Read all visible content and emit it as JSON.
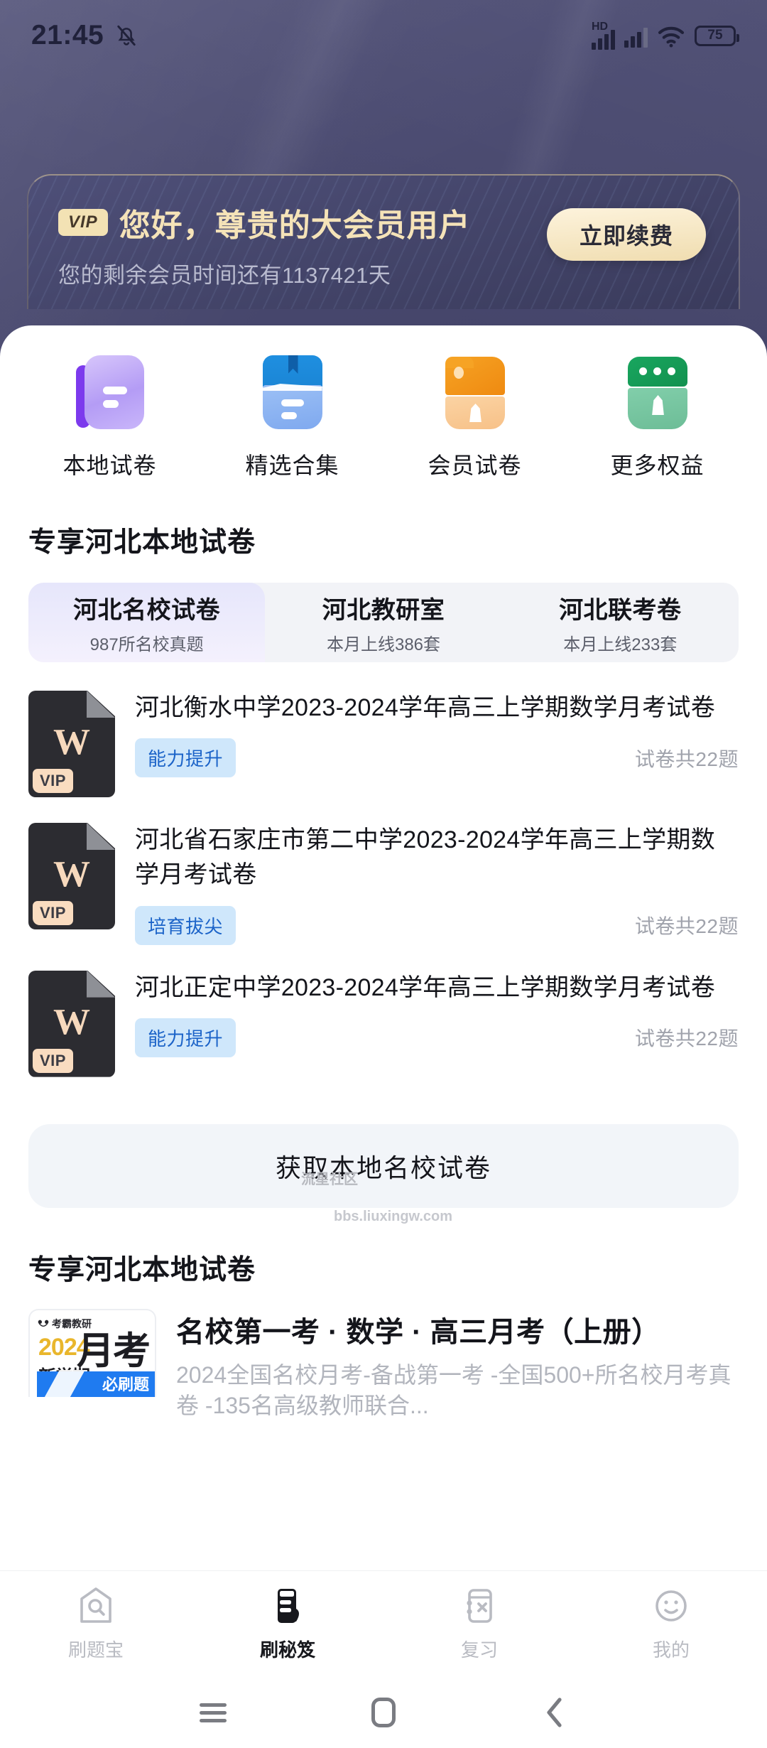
{
  "status_bar": {
    "time": "21:45",
    "mute_icon": "bell-muted-icon",
    "network_label": "HD",
    "signal_icon": "signal-bars-icon",
    "signal_icon_2": "signal-bars-icon",
    "wifi_icon": "wifi-icon",
    "battery_level": "75"
  },
  "vip_card": {
    "badge": "VIP",
    "greeting": "您好，尊贵的大会员用户",
    "remaining": "您的剩余会员时间还有1137421天",
    "renew_button": "立即续费",
    "accent_gold": "#f5e3b8"
  },
  "quick_actions": [
    {
      "label": "本地试卷",
      "icon": "local-papers-icon",
      "color": "#8b5cf6"
    },
    {
      "label": "精选合集",
      "icon": "featured-collection-icon",
      "color": "#1f8fe0"
    },
    {
      "label": "会员试卷",
      "icon": "member-papers-icon",
      "color": "#f5941f"
    },
    {
      "label": "更多权益",
      "icon": "more-benefits-icon",
      "color": "#17a765"
    }
  ],
  "section_one": {
    "title": "专享河北本地试卷",
    "tabs": [
      {
        "label": "河北名校试卷",
        "sub": "987所名校真题",
        "active": true
      },
      {
        "label": "河北教研室",
        "sub": "本月上线386套",
        "active": false
      },
      {
        "label": "河北联考卷",
        "sub": "本月上线233套",
        "active": false
      }
    ],
    "papers": [
      {
        "icon": "word-document-icon",
        "icon_letter": "W",
        "vip_badge": "VIP",
        "title": "河北衡水中学2023-2024学年高三上学期数学月考试卷",
        "tag": "能力提升",
        "count": "试卷共22题"
      },
      {
        "icon": "word-document-icon",
        "icon_letter": "W",
        "vip_badge": "VIP",
        "title": "河北省石家庄市第二中学2023-2024学年高三上学期数学月考试卷",
        "tag": "培育拔尖",
        "count": "试卷共22题"
      },
      {
        "icon": "word-document-icon",
        "icon_letter": "W",
        "vip_badge": "VIP",
        "title": "河北正定中学2023-2024学年高三上学期数学月考试卷",
        "tag": "能力提升",
        "count": "试卷共22题"
      }
    ],
    "cta": "获取本地名校试卷"
  },
  "section_two": {
    "title": "专享河北本地试卷",
    "book": {
      "cover": {
        "brand": "考霸教研",
        "year": "2024",
        "term": "新学期",
        "exam": "月考",
        "band": "必刷题"
      },
      "title": "名校第一考 · 数学 · 高三月考（上册）",
      "desc": "2024全国名校月考-备战第一考 -全国500+所名校月考真卷 -135名高级教师联合..."
    }
  },
  "watermark": {
    "line1": "流星社区",
    "line2": "bbs.liuxingw.com"
  },
  "bottom_tabs": [
    {
      "label": "刷题宝",
      "icon": "search-house-icon",
      "active": false
    },
    {
      "label": "刷秘笈",
      "icon": "secret-book-icon",
      "active": true
    },
    {
      "label": "复习",
      "icon": "review-card-icon",
      "active": false
    },
    {
      "label": "我的",
      "icon": "smiley-face-icon",
      "active": false
    }
  ],
  "android_nav": [
    {
      "icon": "menu-icon"
    },
    {
      "icon": "home-icon"
    },
    {
      "icon": "back-icon"
    }
  ]
}
